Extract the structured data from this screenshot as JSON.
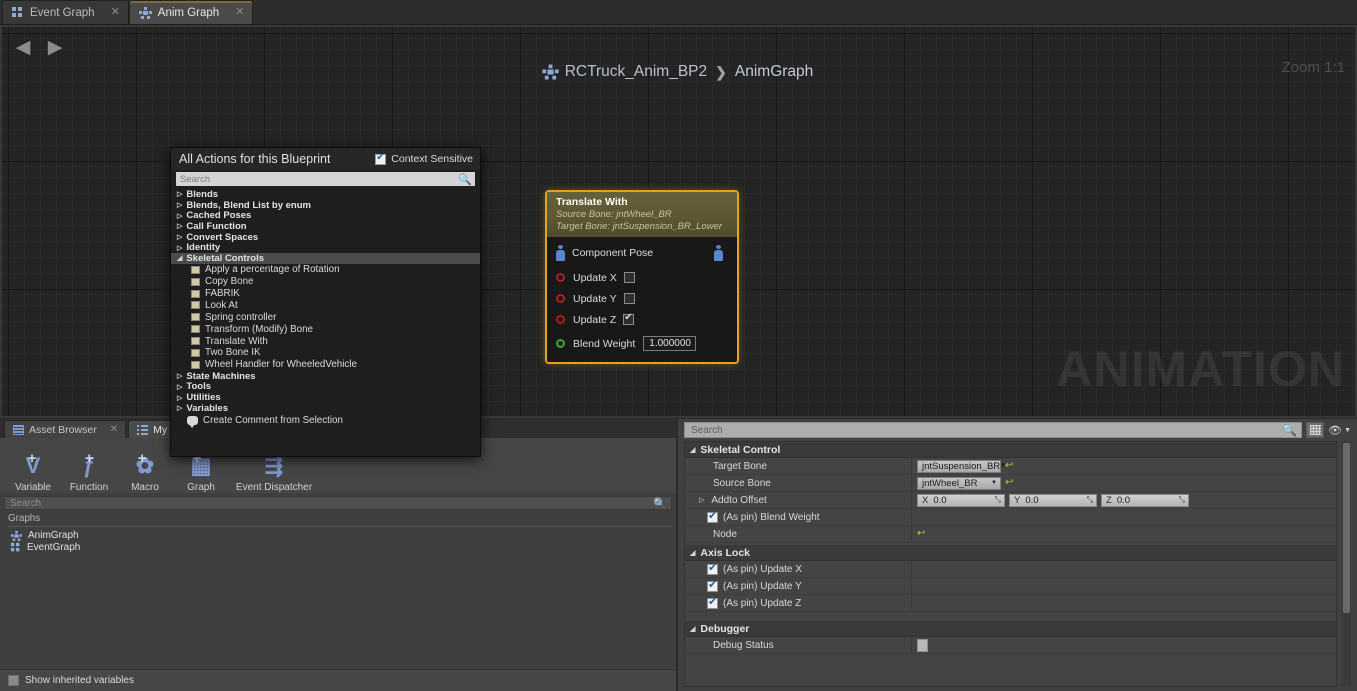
{
  "tabs": [
    {
      "label": "Event Graph",
      "icon": "graph-squares-icon",
      "active": false,
      "close": "✕"
    },
    {
      "label": "Anim Graph",
      "icon": "skeleton-icon",
      "active": true,
      "close": "✕"
    }
  ],
  "graph": {
    "back_arrow": "◀",
    "forward_arrow": "▶",
    "breadcrumb_root": "RCTruck_Anim_BP2",
    "breadcrumb_sep": "❯",
    "breadcrumb_leaf": "AnimGraph",
    "zoom_label": "Zoom 1:1",
    "watermark": "ANIMATION"
  },
  "node": {
    "title": "Translate With",
    "source_bone_line": "Source Bone: jntWheel_BR",
    "target_bone_line": "Target Bone: jntSuspension_BR_Lower",
    "pose_pin_label": "Component Pose",
    "rows": [
      {
        "label": "Update X",
        "checked": false
      },
      {
        "label": "Update Y",
        "checked": false
      },
      {
        "label": "Update Z",
        "checked": true
      }
    ],
    "blend_weight_label": "Blend Weight",
    "blend_weight_value": "1.000000",
    "accent_color": "#e8a020"
  },
  "action_menu": {
    "title": "All Actions for this Blueprint",
    "context_sensitive_label": "Context Sensitive",
    "context_sensitive_checked": true,
    "search_placeholder": "Search",
    "search_icon": "magnifier-icon",
    "categories": [
      {
        "label": "Blends",
        "expanded": false,
        "selected": false
      },
      {
        "label": "Blends, Blend List by enum",
        "expanded": false,
        "selected": false
      },
      {
        "label": "Cached Poses",
        "expanded": false,
        "selected": false
      },
      {
        "label": "Call Function",
        "expanded": false,
        "selected": false
      },
      {
        "label": "Convert Spaces",
        "expanded": false,
        "selected": false
      },
      {
        "label": "Identity",
        "expanded": false,
        "selected": false
      },
      {
        "label": "Skeletal Controls",
        "expanded": true,
        "selected": true
      }
    ],
    "skeletal_items": [
      "Apply a percentage of Rotation",
      "Copy Bone",
      "FABRIK",
      "Look At",
      "Spring controller",
      "Transform (Modify) Bone",
      "Translate With",
      "Two Bone IK",
      "Wheel Handler for WheeledVehicle"
    ],
    "categories_after": [
      {
        "label": "State Machines",
        "expanded": false
      },
      {
        "label": "Tools",
        "expanded": false
      },
      {
        "label": "Utilities",
        "expanded": false
      },
      {
        "label": "Variables",
        "expanded": false
      }
    ],
    "footer_action": "Create Comment from Selection",
    "footer_icon": "comment-icon",
    "collapsed_arrow": "▷",
    "expanded_arrow": "◢"
  },
  "my_blueprint": {
    "tabs": [
      {
        "label": "Asset Browser",
        "icon": "asset-browser-icon",
        "active": false,
        "close": "✕"
      },
      {
        "label": "My Bluep",
        "icon": "my-blueprint-icon",
        "active": true,
        "close": ""
      }
    ],
    "toolbar": [
      {
        "label": "Variable",
        "glyph": "V",
        "plus": "+",
        "icon": "add-variable-icon"
      },
      {
        "label": "Function",
        "glyph": "ƒ",
        "plus": "+",
        "icon": "add-function-icon"
      },
      {
        "label": "Macro",
        "glyph": "✿",
        "plus": "+",
        "icon": "add-macro-icon"
      },
      {
        "label": "Graph",
        "glyph": "▦",
        "plus": "+",
        "icon": "add-graph-icon"
      },
      {
        "label": "Event Dispatcher",
        "glyph": "⇶",
        "plus": "",
        "icon": "add-event-dispatcher-icon"
      }
    ],
    "search_placeholder": "Search",
    "search_icon": "magnifier-icon",
    "section_label": "Graphs",
    "graphs": [
      {
        "label": "AnimGraph",
        "icon": "skeleton-icon"
      },
      {
        "label": "EventGraph",
        "icon": "graph-squares-icon"
      }
    ],
    "show_inherited_label": "Show inherited variables",
    "show_inherited_checked": false
  },
  "details": {
    "search_placeholder": "Search",
    "search_icon": "magnifier-icon",
    "grid_icon": "column-settings-icon",
    "eye_icon": "visibility-icon",
    "caret_icon": "chevron-down-icon",
    "sections": [
      {
        "title": "Skeletal Control",
        "rows": [
          {
            "type": "combo",
            "label": "Target Bone",
            "value": "jntSuspension_BR",
            "revert": true
          },
          {
            "type": "combo",
            "label": "Source Bone",
            "value": "jntWheel_BR",
            "revert": true
          },
          {
            "type": "vector",
            "label": "Addto Offset",
            "expandable": true,
            "components": [
              {
                "axis": "X",
                "value": "0.0"
              },
              {
                "axis": "Y",
                "value": "0.0"
              },
              {
                "axis": "Z",
                "value": "0.0"
              }
            ]
          },
          {
            "type": "checkbox",
            "label": "(As pin) Blend Weight",
            "checked": true
          },
          {
            "type": "revert-only",
            "label": "Node",
            "revert": true
          }
        ]
      },
      {
        "title": "Axis Lock",
        "rows": [
          {
            "type": "checkbox",
            "label": "(As pin) Update X",
            "checked": true
          },
          {
            "type": "checkbox",
            "label": "(As pin) Update Y",
            "checked": true
          },
          {
            "type": "checkbox",
            "label": "(As pin) Update Z",
            "checked": true
          }
        ]
      },
      {
        "title": "Debugger",
        "rows": [
          {
            "type": "blank-box",
            "label": "Debug Status"
          }
        ]
      }
    ],
    "expanded_arrow": "◢",
    "collapsed_arrow": "▷",
    "revert_glyph": "↩"
  }
}
